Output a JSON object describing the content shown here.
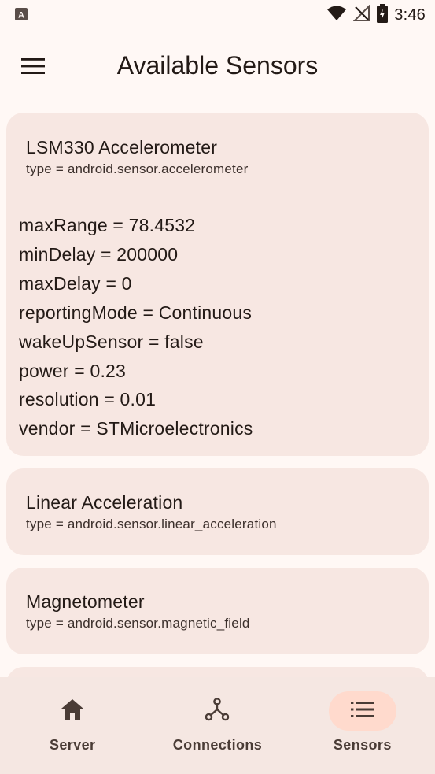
{
  "status_bar": {
    "time": "3:46",
    "icons": [
      "app-notification-icon",
      "wifi-icon",
      "no-signal-icon",
      "battery-charging-icon"
    ]
  },
  "app_bar": {
    "menu_icon": "hamburger-menu-icon",
    "title": "Available Sensors"
  },
  "sensors": [
    {
      "name": "LSM330 Accelerometer",
      "type": "type = android.sensor.accelerometer",
      "details": [
        "maxRange = 78.4532",
        "minDelay = 200000",
        "maxDelay = 0",
        "reportingMode = Continuous",
        "wakeUpSensor = false",
        "power = 0.23",
        "resolution = 0.01",
        "vendor = STMicroelectronics"
      ]
    },
    {
      "name": "Linear Acceleration",
      "type": "type = android.sensor.linear_acceleration"
    },
    {
      "name": "Magnetometer",
      "type": "type = android.sensor.magnetic_field"
    }
  ],
  "bottom_nav": {
    "items": [
      {
        "label": "Server",
        "icon": "home-icon",
        "active": false
      },
      {
        "label": "Connections",
        "icon": "hub-icon",
        "active": false
      },
      {
        "label": "Sensors",
        "icon": "list-icon",
        "active": true
      }
    ]
  },
  "colors": {
    "background": "#fff8f5",
    "card": "#f7e7e2",
    "nav_background": "#f5e7e2",
    "active_indicator": "#ffdacd",
    "text": "#231a16"
  }
}
